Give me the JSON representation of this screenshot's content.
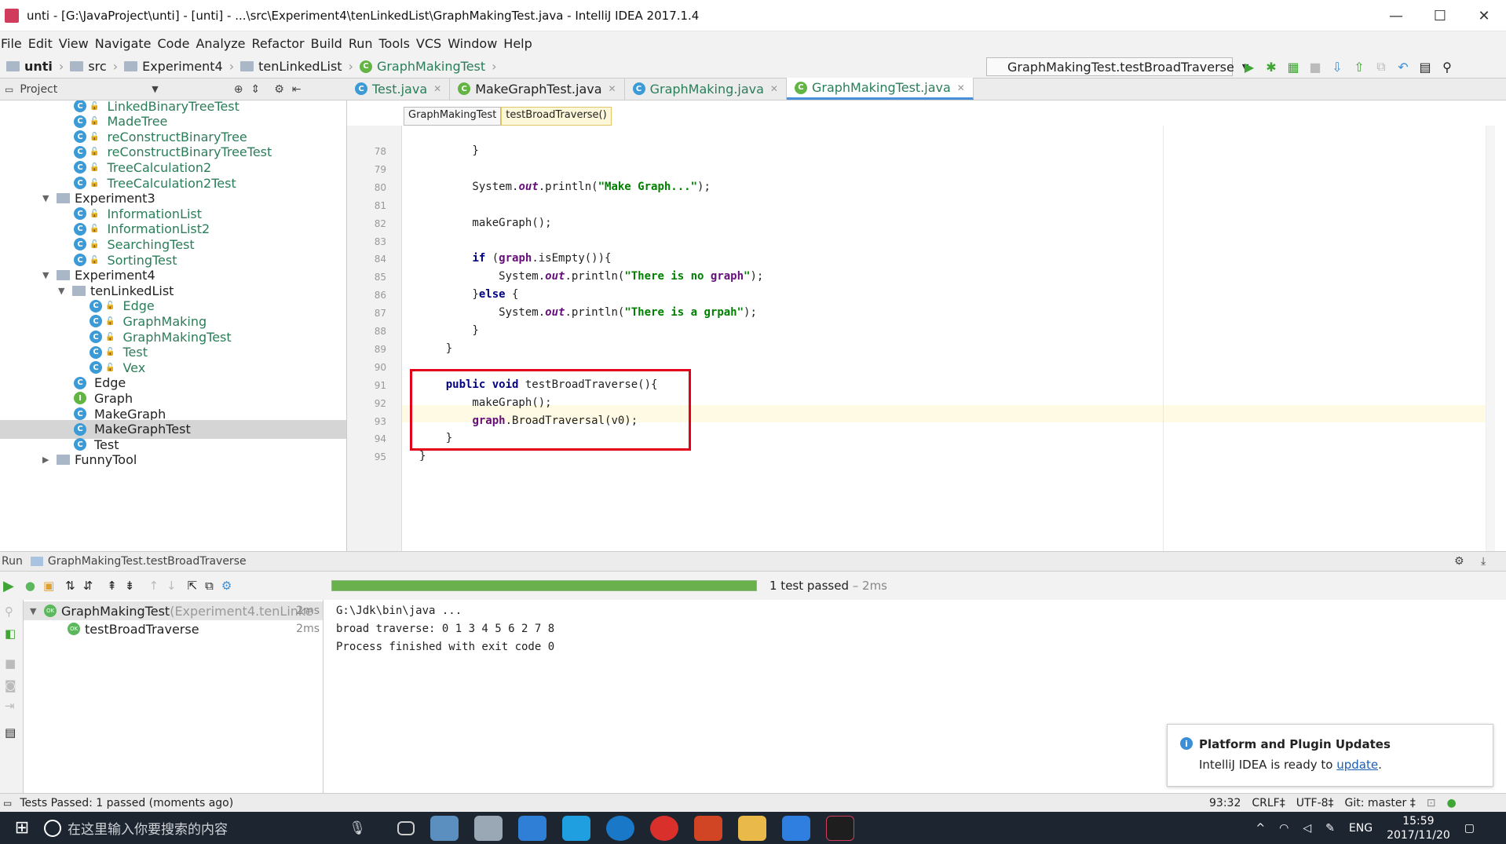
{
  "window": {
    "title": "unti - [G:\\JavaProject\\unti] - [unti] - ...\\src\\Experiment4\\tenLinkedList\\GraphMakingTest.java - IntelliJ IDEA 2017.1.4",
    "minimize": "—",
    "maximize": "☐",
    "close": "✕"
  },
  "menu": [
    "File",
    "Edit",
    "View",
    "Navigate",
    "Code",
    "Analyze",
    "Refactor",
    "Build",
    "Run",
    "Tools",
    "VCS",
    "Window",
    "Help"
  ],
  "breadcrumbs": [
    "unti",
    "src",
    "Experiment4",
    "tenLinkedList",
    "GraphMakingTest"
  ],
  "run_config": "GraphMakingTest.testBroadTraverse",
  "project_panel": {
    "title": "Project",
    "items": [
      {
        "label": "LinkedBinaryTreeTest",
        "kind": "test",
        "indent": 4
      },
      {
        "label": "MadeTree",
        "kind": "class",
        "indent": 4
      },
      {
        "label": "reConstructBinaryTree",
        "kind": "class",
        "indent": 4
      },
      {
        "label": "reConstructBinaryTreeTest",
        "kind": "test",
        "indent": 4
      },
      {
        "label": "TreeCalculation2",
        "kind": "class",
        "indent": 4
      },
      {
        "label": "TreeCalculation2Test",
        "kind": "test",
        "indent": 4
      },
      {
        "label": "Experiment3",
        "kind": "folder",
        "indent": 2
      },
      {
        "label": "InformationList",
        "kind": "class",
        "indent": 4
      },
      {
        "label": "InformationList2",
        "kind": "class",
        "indent": 4
      },
      {
        "label": "SearchingTest",
        "kind": "test",
        "indent": 4
      },
      {
        "label": "SortingTest",
        "kind": "test",
        "indent": 4
      },
      {
        "label": "Experiment4",
        "kind": "folder",
        "indent": 2
      },
      {
        "label": "tenLinkedList",
        "kind": "folder",
        "indent": 3
      },
      {
        "label": "Edge",
        "kind": "class",
        "indent": 5
      },
      {
        "label": "GraphMaking",
        "kind": "class",
        "indent": 5
      },
      {
        "label": "GraphMakingTest",
        "kind": "test",
        "indent": 5
      },
      {
        "label": "Test",
        "kind": "class",
        "indent": 5
      },
      {
        "label": "Vex",
        "kind": "class",
        "indent": 5
      },
      {
        "label": "Edge",
        "kind": "class-plain",
        "indent": 4
      },
      {
        "label": "Graph",
        "kind": "interface",
        "indent": 4
      },
      {
        "label": "MakeGraph",
        "kind": "class-plain",
        "indent": 4
      },
      {
        "label": "MakeGraphTest",
        "kind": "test-plain",
        "indent": 4
      },
      {
        "label": "Test",
        "kind": "class-plain",
        "indent": 4
      },
      {
        "label": "FunnyTool",
        "kind": "folder-collapsed",
        "indent": 2
      }
    ]
  },
  "tabs": [
    {
      "label": "Test.java",
      "active": false
    },
    {
      "label": "MakeGraphTest.java",
      "active": false
    },
    {
      "label": "GraphMaking.java",
      "active": false
    },
    {
      "label": "GraphMakingTest.java",
      "active": true
    }
  ],
  "editor_crumbs": [
    "GraphMakingTest",
    "testBroadTraverse()"
  ],
  "code_lines": [
    {
      "n": "78",
      "text": "        }"
    },
    {
      "n": "79",
      "text": ""
    },
    {
      "n": "80",
      "text": "        System.out.println(\"Make Graph...\");"
    },
    {
      "n": "81",
      "text": ""
    },
    {
      "n": "82",
      "text": "        makeGraph();"
    },
    {
      "n": "83",
      "text": ""
    },
    {
      "n": "84",
      "text": "        if (graph.isEmpty()){"
    },
    {
      "n": "85",
      "text": "            System.out.println(\"There is no graph\");"
    },
    {
      "n": "86",
      "text": "        }else {"
    },
    {
      "n": "87",
      "text": "            System.out.println(\"There is a grpah\");"
    },
    {
      "n": "88",
      "text": "        }"
    },
    {
      "n": "89",
      "text": "    }"
    },
    {
      "n": "90",
      "text": ""
    },
    {
      "n": "91",
      "text": "    public void testBroadTraverse(){"
    },
    {
      "n": "92",
      "text": "        makeGraph();"
    },
    {
      "n": "93",
      "text": "        graph.BroadTraversal(v0);"
    },
    {
      "n": "94",
      "text": "    }"
    },
    {
      "n": "95",
      "text": "}"
    }
  ],
  "run_panel": {
    "title": "Run",
    "config": "GraphMakingTest.testBroadTraverse",
    "progress": 1.0,
    "result": "1 test passed",
    "result_time": " – 2ms",
    "tests": [
      {
        "label": "GraphMakingTest",
        "detail": " (Experiment4.tenLinke",
        "time": "2ms"
      },
      {
        "label": "testBroadTraverse",
        "detail": "",
        "time": "2ms"
      }
    ],
    "console": [
      "G:\\Jdk\\bin\\java ...",
      "broad traverse: 0 1 3 4 5 6 2 7 8",
      "Process finished with exit code 0"
    ]
  },
  "notification": {
    "title": "Platform and Plugin Updates",
    "message": "IntelliJ IDEA is ready to ",
    "link": "update",
    "tail": "."
  },
  "status": {
    "left": "Tests Passed: 1 passed (moments ago)",
    "position": "93:32",
    "line_sep": "CRLF‡",
    "encoding": "UTF-8‡",
    "vcs": "Git: master ‡"
  },
  "taskbar": {
    "search_placeholder": "在这里输入你要搜索的内容",
    "lang": "ENG",
    "time": "15:59",
    "date": "2017/11/20"
  },
  "colors": {
    "accent": "#4a90d9",
    "highlight_box": "#e3001b",
    "pass_green": "#6ab04c"
  }
}
